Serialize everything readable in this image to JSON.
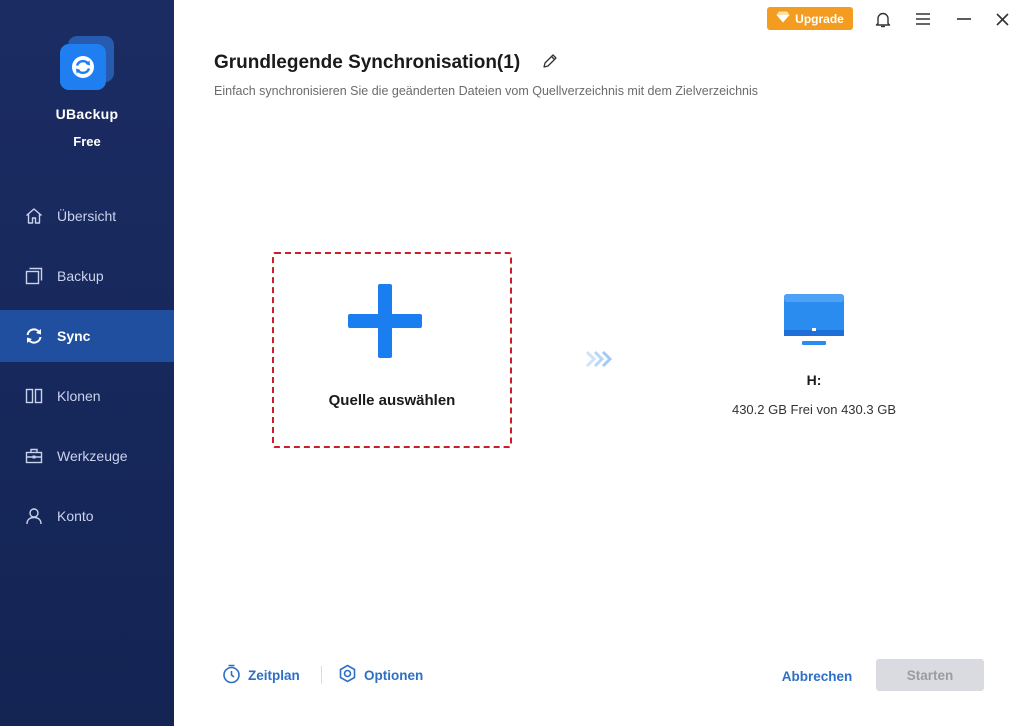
{
  "app": {
    "name": "UBackup",
    "edition": "Free"
  },
  "sidebar": {
    "items": [
      {
        "label": "Übersicht",
        "icon": "home-icon",
        "active": false
      },
      {
        "label": "Backup",
        "icon": "backup-icon",
        "active": false
      },
      {
        "label": "Sync",
        "icon": "sync-icon",
        "active": true
      },
      {
        "label": "Klonen",
        "icon": "clone-icon",
        "active": false
      },
      {
        "label": "Werkzeuge",
        "icon": "toolbox-icon",
        "active": false
      },
      {
        "label": "Konto",
        "icon": "user-icon",
        "active": false
      }
    ]
  },
  "topbar": {
    "upgrade_label": "Upgrade"
  },
  "header": {
    "title": "Grundlegende Synchronisation(1)",
    "subtitle": "Einfach synchronisieren Sie die geänderten Dateien vom Quellverzeichnis mit dem Zielverzeichnis"
  },
  "source": {
    "label": "Quelle auswählen"
  },
  "target": {
    "drive": "H:",
    "space": "430.2 GB Frei von 430.3 GB"
  },
  "footer": {
    "schedule_label": "Zeitplan",
    "options_label": "Optionen",
    "cancel_label": "Abbrechen",
    "start_label": "Starten"
  },
  "colors": {
    "sidebar_bg": "#1b2c63",
    "active_item_bg": "#1f4f9e",
    "accent_blue": "#1a7ef0",
    "upgrade_orange": "#f39c1f",
    "dashed_border_red": "#c7202a",
    "disabled_button": "#d9dbe0"
  }
}
